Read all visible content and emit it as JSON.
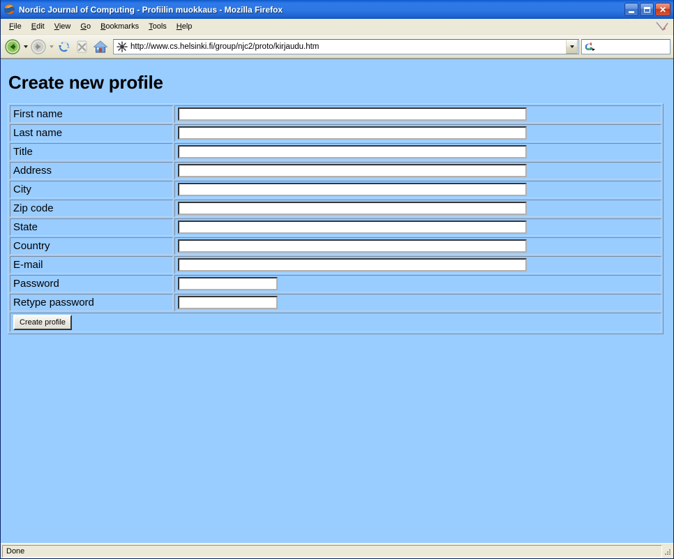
{
  "window": {
    "title": "Nordic Journal of Computing - Profiilin muokkaus - Mozilla Firefox",
    "app_icon": "firefox-logo",
    "controls": {
      "minimize": "minimize-button",
      "maximize": "maximize-button",
      "close": "close-button",
      "close_glyph": "✕"
    }
  },
  "menubar": {
    "items": [
      {
        "label": "File"
      },
      {
        "label": "Edit"
      },
      {
        "label": "View"
      },
      {
        "label": "Go"
      },
      {
        "label": "Bookmarks"
      },
      {
        "label": "Tools"
      },
      {
        "label": "Help"
      }
    ]
  },
  "toolbar": {
    "back": "back-button",
    "forward": "forward-button",
    "reload": "reload-button",
    "stop": "stop-button",
    "home": "home-button",
    "url": "http://www.cs.helsinki.fi/group/njc2/proto/kirjaudu.htm",
    "url_placeholder": "",
    "search_placeholder": "",
    "search_value": "",
    "search_engine_icon": "google-g-icon"
  },
  "page": {
    "heading": "Create new profile",
    "background_color": "#99ccff",
    "fields": [
      {
        "label": "First name",
        "value": "",
        "type": "text",
        "name": "first-name"
      },
      {
        "label": "Last name",
        "value": "",
        "type": "text",
        "name": "last-name"
      },
      {
        "label": "Title",
        "value": "",
        "type": "text",
        "name": "title"
      },
      {
        "label": "Address",
        "value": "",
        "type": "text",
        "name": "address"
      },
      {
        "label": "City",
        "value": "",
        "type": "text",
        "name": "city"
      },
      {
        "label": "Zip code",
        "value": "",
        "type": "text",
        "name": "zip-code"
      },
      {
        "label": "State",
        "value": "",
        "type": "text",
        "name": "state"
      },
      {
        "label": "Country",
        "value": "",
        "type": "text",
        "name": "country"
      },
      {
        "label": "E-mail",
        "value": "",
        "type": "text",
        "name": "email"
      },
      {
        "label": "Password",
        "value": "",
        "type": "password",
        "name": "password"
      },
      {
        "label": "Retype password",
        "value": "",
        "type": "password",
        "name": "retype-password"
      }
    ],
    "submit_label": "Create profile"
  },
  "statusbar": {
    "text": "Done"
  }
}
